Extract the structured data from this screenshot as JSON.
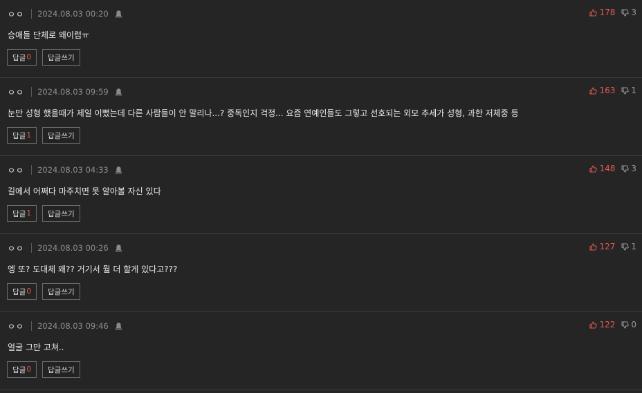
{
  "comments": [
    {
      "nickname": "ㅇㅇ",
      "date": "2024.08.03 00:20",
      "text": "승애들 단체로 왜이럼ㅠ",
      "upvotes": "178",
      "downvotes": "3",
      "reply_label": "답글",
      "reply_count": "0",
      "write_reply_label": "답글쓰기"
    },
    {
      "nickname": "ㅇㅇ",
      "date": "2024.08.03 09:59",
      "text": "눈만 성형 했을때가 제일 이뻤는데 다른 사람들이 안 말리나...? 중독인지 걱정... 요즘 연예인들도 그렇고 선호되는 외모 추세가 성형, 과한 저체중 등",
      "upvotes": "163",
      "downvotes": "1",
      "reply_label": "답글",
      "reply_count": "1",
      "write_reply_label": "답글쓰기"
    },
    {
      "nickname": "ㅇㅇ",
      "date": "2024.08.03 04:33",
      "text": "길에서 어쩌다 마주치면 못 알아볼 자신 있다",
      "upvotes": "148",
      "downvotes": "3",
      "reply_label": "답글",
      "reply_count": "1",
      "write_reply_label": "답글쓰기"
    },
    {
      "nickname": "ㅇㅇ",
      "date": "2024.08.03 00:26",
      "text": "엥 또? 도대체 왜?? 거기서 뭘 더 할게 있다고???",
      "upvotes": "127",
      "downvotes": "1",
      "reply_label": "답글",
      "reply_count": "0",
      "write_reply_label": "답글쓰기"
    },
    {
      "nickname": "ㅇㅇ",
      "date": "2024.08.03 09:46",
      "text": "얼굴 그만 고쳐..",
      "upvotes": "122",
      "downvotes": "0",
      "reply_label": "답글",
      "reply_count": "0",
      "write_reply_label": "답글쓰기"
    }
  ],
  "icons": {
    "report": "bell-icon",
    "upvote": "thumbs-up-icon",
    "downvote": "thumbs-down-icon"
  },
  "colors": {
    "background": "#252525",
    "upvote": "#e05a52",
    "downvote": "#9a9a9a",
    "reply_count": "#e05a52",
    "divider": "#3e3e3e"
  }
}
